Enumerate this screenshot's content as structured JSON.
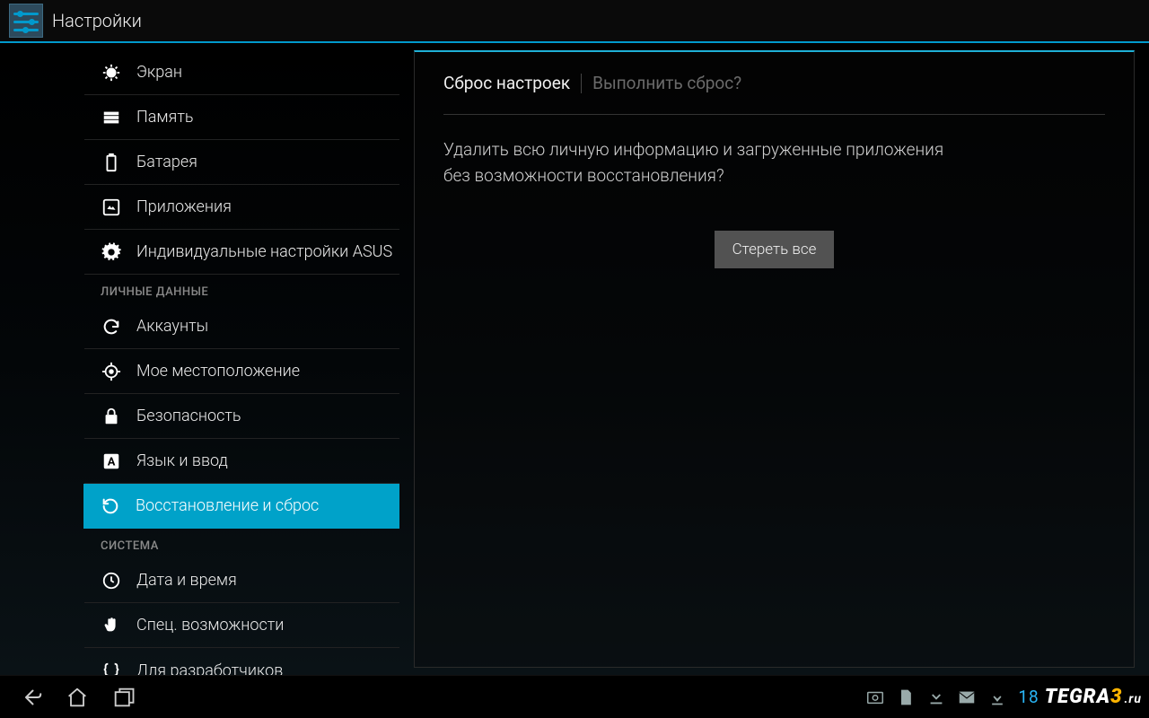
{
  "header": {
    "title": "Настройки"
  },
  "nav": {
    "items": [
      {
        "label": "Экран",
        "icon": "display"
      },
      {
        "label": "Память",
        "icon": "storage"
      },
      {
        "label": "Батарея",
        "icon": "battery"
      },
      {
        "label": "Приложения",
        "icon": "apps"
      },
      {
        "label": "Индивидуальные настройки ASUS",
        "icon": "gear"
      }
    ],
    "section_personal": "ЛИЧНЫЕ ДАННЫЕ",
    "items_personal": [
      {
        "label": "Аккаунты",
        "icon": "sync"
      },
      {
        "label": "Мое местоположение",
        "icon": "location"
      },
      {
        "label": "Безопасность",
        "icon": "lock"
      },
      {
        "label": "Язык и ввод",
        "icon": "language"
      },
      {
        "label": "Восстановление и сброс",
        "icon": "restore",
        "selected": true
      }
    ],
    "section_system": "СИСТЕМА",
    "items_system": [
      {
        "label": "Дата и время",
        "icon": "clock"
      },
      {
        "label": "Спец. возможности",
        "icon": "hand"
      },
      {
        "label": "Для разработчиков",
        "icon": "braces"
      }
    ]
  },
  "detail": {
    "crumb_current": "Сброс настроек",
    "crumb_trail": "Выполнить сброс?",
    "body_line1": "Удалить всю личную информацию и загруженные приложения",
    "body_line2": "без возможности восстановления?",
    "erase_label": "Стереть все"
  },
  "sysbar": {
    "clock": "18",
    "watermark_a": "TEGRA",
    "watermark_b": "3",
    "watermark_c": ".ru"
  }
}
